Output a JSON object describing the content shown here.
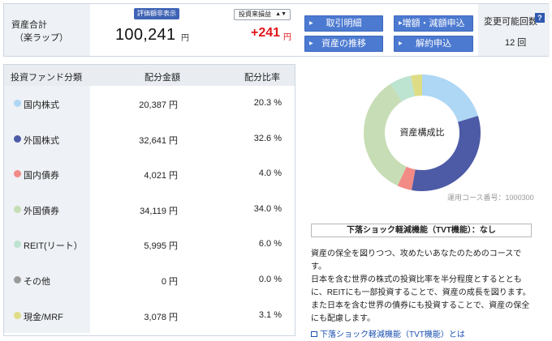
{
  "summary": {
    "total_label": "資産合計",
    "total_sub": "（楽ラップ）",
    "toggle_label": "評価額非表示",
    "total_value": "100,241",
    "total_unit": "円",
    "profit_select": "投資来損益",
    "profit_value": "+241",
    "profit_unit": "円",
    "count_label": "変更可能回数",
    "count_value": "12 回"
  },
  "actions": {
    "history": "取引明細",
    "increase": "増額・減額申込",
    "asset_trend": "資産の推移",
    "cancel": "解約申込"
  },
  "table": {
    "headers": [
      "投資ファンド分類",
      "配分金額",
      "配分比率"
    ],
    "rows": [
      {
        "name": "国内株式",
        "amount": "20,387 円",
        "pct": "20.3 %",
        "color": "#aed6f5"
      },
      {
        "name": "外国株式",
        "amount": "32,641 円",
        "pct": "32.6 %",
        "color": "#4d5aa6"
      },
      {
        "name": "国内債券",
        "amount": "4,021 円",
        "pct": "4.0 %",
        "color": "#f28a86"
      },
      {
        "name": "外国債券",
        "amount": "34,119 円",
        "pct": "34.0 %",
        "color": "#c7ddb5"
      },
      {
        "name": "REIT(リート）",
        "amount": "5,995 円",
        "pct": "6.0 %",
        "color": "#bde3d1"
      },
      {
        "name": "その他",
        "amount": "0 円",
        "pct": "0.0 %",
        "color": "#9a9a9a"
      },
      {
        "name": "現金/MRF",
        "amount": "3,078 円",
        "pct": "3.1 %",
        "color": "#dedd86"
      }
    ]
  },
  "chart_data": {
    "type": "pie",
    "title": "資産構成比",
    "categories": [
      "国内株式",
      "外国株式",
      "国内債券",
      "外国債券",
      "REIT(リート）",
      "その他",
      "現金/MRF"
    ],
    "values": [
      20.3,
      32.6,
      4.0,
      34.0,
      6.0,
      0.0,
      3.1
    ],
    "colors": [
      "#aed6f5",
      "#4d5aa6",
      "#f28a86",
      "#c7ddb5",
      "#bde3d1",
      "#9a9a9a",
      "#dedd86"
    ]
  },
  "info": {
    "course_no": "運用コース番号：1000300",
    "tvt_title": "下落ショック軽減機能（TVT機能）：なし",
    "desc": "資産の保全を図りつつ、攻めたいあなたのためのコースです。\n日本を含む世界の株式の投資比率を半分程度とするとともに、REITにも一部投資することで、資産の成長を図ります。また日本を含む世界の債券にも投資することで、資産の保全にも配慮します。",
    "tvt_link": "下落ショック軽減機能（TVT機能）とは"
  }
}
